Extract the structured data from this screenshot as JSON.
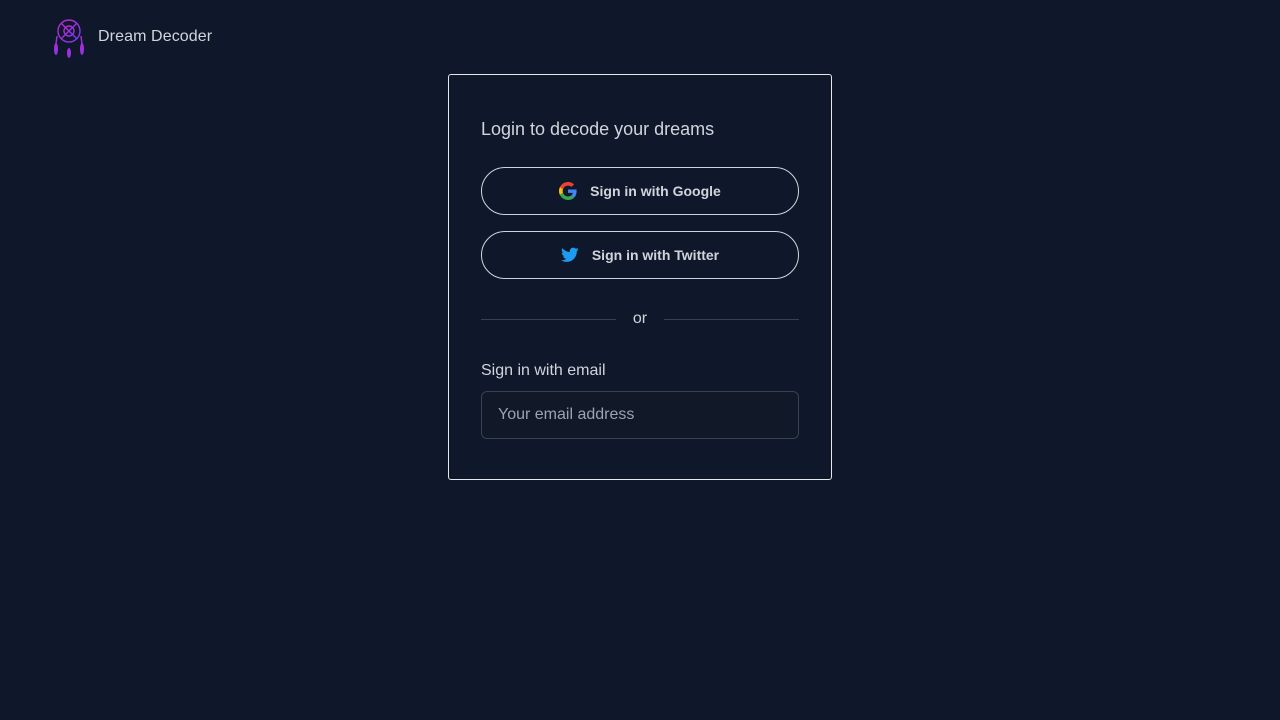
{
  "header": {
    "app_name": "Dream Decoder",
    "logo_icon": "dreamcatcher-icon"
  },
  "login": {
    "title": "Login to decode your dreams",
    "google_label": "Sign in with Google",
    "twitter_label": "Sign in with Twitter",
    "divider_text": "or",
    "email_label": "Sign in with email",
    "email_placeholder": "Your email address",
    "email_value": ""
  },
  "colors": {
    "background": "#0f172a",
    "text": "#d1d5db",
    "twitter_blue": "#1d9bf0",
    "logo_pink": "#c026d3",
    "logo_purple": "#7c3aed"
  }
}
